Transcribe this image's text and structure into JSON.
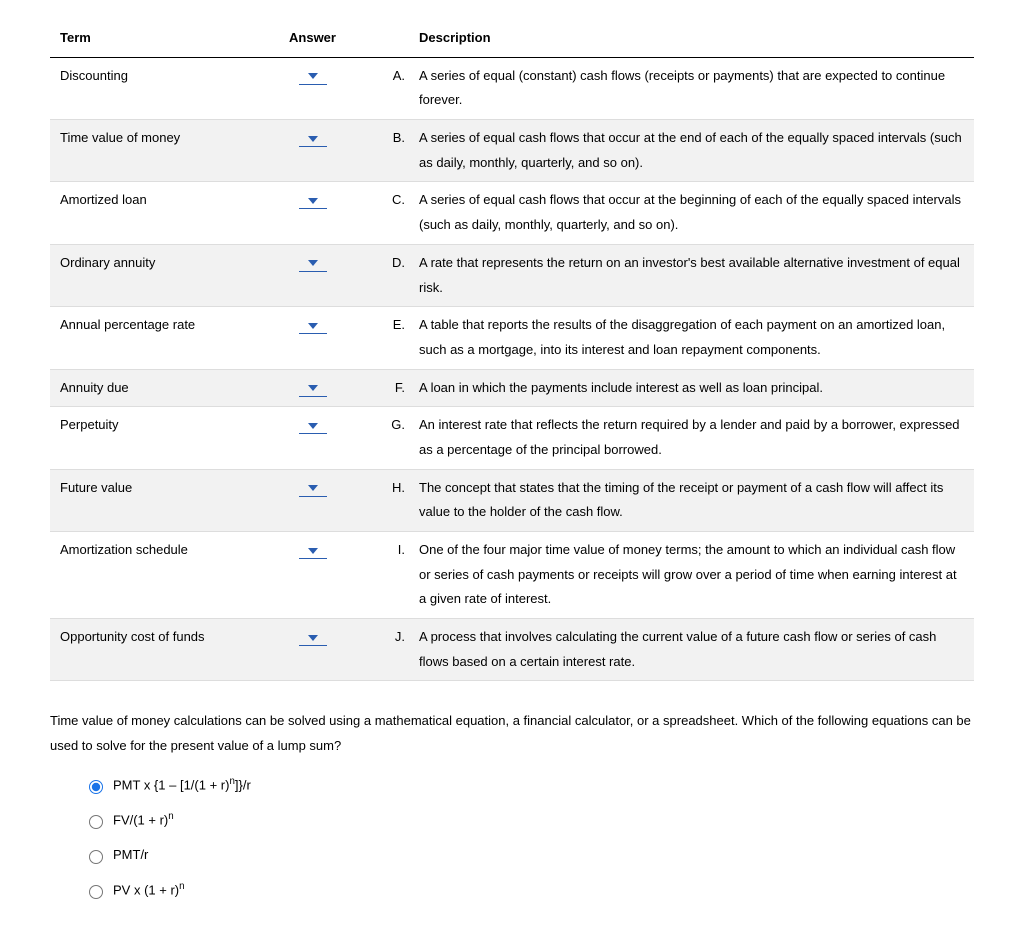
{
  "table": {
    "headers": {
      "term": "Term",
      "answer": "Answer",
      "description": "Description"
    },
    "rows": [
      {
        "term": "Discounting",
        "letter": "A.",
        "desc": "A series of equal (constant) cash flows (receipts or payments) that are expected to continue forever.",
        "shaded": false
      },
      {
        "term": "Time value of money",
        "letter": "B.",
        "desc": "A series of equal cash flows that occur at the end of each of the equally spaced intervals (such as daily, monthly, quarterly, and so on).",
        "shaded": true
      },
      {
        "term": "Amortized loan",
        "letter": "C.",
        "desc": "A series of equal cash flows that occur at the beginning of each of the equally spaced intervals (such as daily, monthly, quarterly, and so on).",
        "shaded": false
      },
      {
        "term": "Ordinary annuity",
        "letter": "D.",
        "desc": "A rate that represents the return on an investor's best available alternative investment of equal risk.",
        "shaded": true
      },
      {
        "term": "Annual percentage rate",
        "letter": "E.",
        "desc": "A table that reports the results of the disaggregation of each payment on an amortized loan, such as a mortgage, into its interest and loan repayment components.",
        "shaded": false
      },
      {
        "term": "Annuity due",
        "letter": "F.",
        "desc": "A loan in which the payments include interest as well as loan principal.",
        "shaded": true
      },
      {
        "term": "Perpetuity",
        "letter": "G.",
        "desc": "An interest rate that reflects the return required by a lender and paid by a borrower, expressed as a percentage of the principal borrowed.",
        "shaded": false
      },
      {
        "term": "Future value",
        "letter": "H.",
        "desc": "The concept that states that the timing of the receipt or payment of a cash flow will affect its value to the holder of the cash flow.",
        "shaded": true
      },
      {
        "term": "Amortization schedule",
        "letter": "I.",
        "desc": "One of the four major time value of money terms; the amount to which an individual cash flow or series of cash payments or receipts will grow over a period of time when earning interest at a given rate of interest.",
        "shaded": false
      },
      {
        "term": "Opportunity cost of funds",
        "letter": "J.",
        "desc": "A process that involves calculating the current value of a future cash flow or series of cash flows based on a certain interest rate.",
        "shaded": true
      }
    ]
  },
  "question": "Time value of money calculations can be solved using a mathematical equation, a financial calculator, or a spreadsheet. Which of the following equations can be used to solve for the present value of a lump sum?",
  "options": [
    {
      "html": "PMT x {1 – [1/(1 + r)<sup>n</sup>]}/r",
      "checked": true
    },
    {
      "html": "FV/(1 + r)<sup>n</sup>",
      "checked": false
    },
    {
      "html": "PMT/r",
      "checked": false
    },
    {
      "html": "PV x (1 + r)<sup>n</sup>",
      "checked": false
    }
  ]
}
